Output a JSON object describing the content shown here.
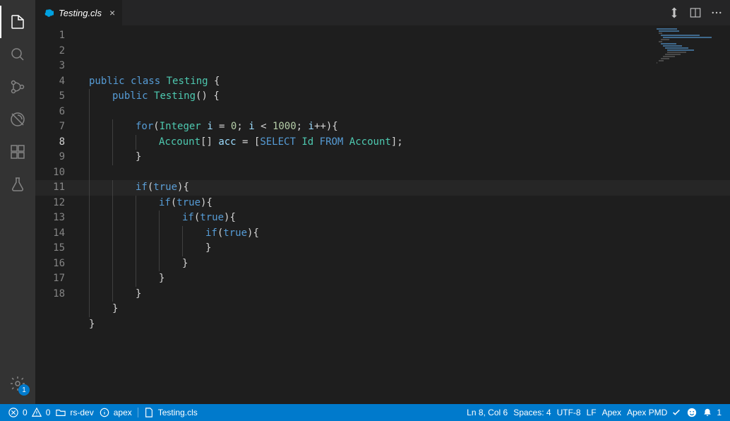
{
  "tab": {
    "filename": "Testing.cls"
  },
  "editor": {
    "current_line": 8,
    "lines": [
      {
        "n": 1,
        "indent": 0,
        "tokens": [
          {
            "t": "public",
            "c": "kw"
          },
          {
            "t": " ",
            "c": "pl"
          },
          {
            "t": "class",
            "c": "kw"
          },
          {
            "t": " ",
            "c": "pl"
          },
          {
            "t": "Testing",
            "c": "type"
          },
          {
            "t": " {",
            "c": "pl"
          }
        ]
      },
      {
        "n": 2,
        "indent": 1,
        "tokens": [
          {
            "t": "public",
            "c": "kw"
          },
          {
            "t": " ",
            "c": "pl"
          },
          {
            "t": "Testing",
            "c": "type"
          },
          {
            "t": "() {",
            "c": "pl"
          }
        ]
      },
      {
        "n": 3,
        "indent": 1,
        "tokens": []
      },
      {
        "n": 4,
        "indent": 2,
        "tokens": [
          {
            "t": "for",
            "c": "kw"
          },
          {
            "t": "(",
            "c": "pl"
          },
          {
            "t": "Integer",
            "c": "type"
          },
          {
            "t": " ",
            "c": "pl"
          },
          {
            "t": "i",
            "c": "var"
          },
          {
            "t": " = ",
            "c": "pl"
          },
          {
            "t": "0",
            "c": "num"
          },
          {
            "t": "; ",
            "c": "pl"
          },
          {
            "t": "i",
            "c": "var"
          },
          {
            "t": " < ",
            "c": "pl"
          },
          {
            "t": "1000",
            "c": "num"
          },
          {
            "t": "; ",
            "c": "pl"
          },
          {
            "t": "i",
            "c": "var"
          },
          {
            "t": "++){",
            "c": "pl"
          }
        ]
      },
      {
        "n": 5,
        "indent": 3,
        "tokens": [
          {
            "t": "Account",
            "c": "type"
          },
          {
            "t": "[] ",
            "c": "pl"
          },
          {
            "t": "acc",
            "c": "var"
          },
          {
            "t": " = [",
            "c": "pl"
          },
          {
            "t": "SELECT",
            "c": "kw"
          },
          {
            "t": " ",
            "c": "pl"
          },
          {
            "t": "Id",
            "c": "type"
          },
          {
            "t": " ",
            "c": "pl"
          },
          {
            "t": "FROM",
            "c": "kw"
          },
          {
            "t": " ",
            "c": "pl"
          },
          {
            "t": "Account",
            "c": "type"
          },
          {
            "t": "];",
            "c": "pl"
          }
        ]
      },
      {
        "n": 6,
        "indent": 2,
        "tokens": [
          {
            "t": "}",
            "c": "pl"
          }
        ]
      },
      {
        "n": 7,
        "indent": 1,
        "tokens": []
      },
      {
        "n": 8,
        "indent": 2,
        "tokens": [
          {
            "t": "if",
            "c": "kw"
          },
          {
            "t": "(",
            "c": "pl"
          },
          {
            "t": "true",
            "c": "const"
          },
          {
            "t": "){",
            "c": "pl"
          }
        ]
      },
      {
        "n": 9,
        "indent": 3,
        "tokens": [
          {
            "t": "if",
            "c": "kw"
          },
          {
            "t": "(",
            "c": "pl"
          },
          {
            "t": "true",
            "c": "const"
          },
          {
            "t": "){",
            "c": "pl"
          }
        ]
      },
      {
        "n": 10,
        "indent": 4,
        "tokens": [
          {
            "t": "if",
            "c": "kw"
          },
          {
            "t": "(",
            "c": "pl"
          },
          {
            "t": "true",
            "c": "const"
          },
          {
            "t": "){",
            "c": "pl"
          }
        ]
      },
      {
        "n": 11,
        "indent": 5,
        "tokens": [
          {
            "t": "if",
            "c": "kw"
          },
          {
            "t": "(",
            "c": "pl"
          },
          {
            "t": "true",
            "c": "const"
          },
          {
            "t": "){",
            "c": "pl"
          }
        ]
      },
      {
        "n": 12,
        "indent": 5,
        "tokens": [
          {
            "t": "}",
            "c": "pl"
          }
        ]
      },
      {
        "n": 13,
        "indent": 4,
        "tokens": [
          {
            "t": "}",
            "c": "pl"
          }
        ]
      },
      {
        "n": 14,
        "indent": 3,
        "tokens": [
          {
            "t": "}",
            "c": "pl"
          }
        ]
      },
      {
        "n": 15,
        "indent": 2,
        "tokens": [
          {
            "t": "}",
            "c": "pl"
          }
        ]
      },
      {
        "n": 16,
        "indent": 1,
        "tokens": [
          {
            "t": "}",
            "c": "pl"
          }
        ]
      },
      {
        "n": 17,
        "indent": 0,
        "tokens": [
          {
            "t": "}",
            "c": "pl"
          }
        ]
      },
      {
        "n": 18,
        "indent": 0,
        "tokens": []
      }
    ]
  },
  "gear_badge": "1",
  "status": {
    "errors": "0",
    "warnings": "0",
    "branch": "rs-dev",
    "lang_server": "apex",
    "file_short": "Testing.cls",
    "pos": "Ln 8, Col 6",
    "spaces": "Spaces: 4",
    "encoding": "UTF-8",
    "eol": "LF",
    "language": "Apex",
    "pmd": "Apex PMD",
    "bell": "1"
  }
}
